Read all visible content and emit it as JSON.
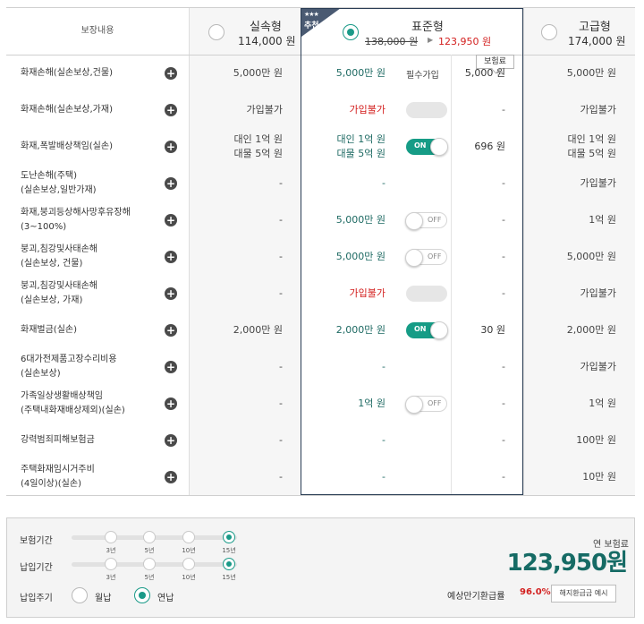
{
  "header": {
    "coverage_label": "보장내용",
    "plans": [
      {
        "name": "실속형",
        "price": "114,000 원",
        "selected": false
      },
      {
        "name": "표준형",
        "old_price": "138,000 원",
        "price": "123,950 원",
        "selected": true,
        "badge_stars": "★★★",
        "badge": "추천"
      },
      {
        "name": "고급형",
        "price": "174,000 원",
        "selected": false
      }
    ]
  },
  "fee_tooltip": "보험료",
  "rows": [
    {
      "label": [
        "화재손해(실손보상,건물)"
      ],
      "basic": [
        "5,000만 원"
      ],
      "standard": [
        "5,000만 원"
      ],
      "standard_style": "value",
      "control": "mandatory",
      "control_text": "필수가입",
      "fee": "5,000 원",
      "premium": [
        "5,000만 원"
      ]
    },
    {
      "label": [
        "화재손해(실손보상,가재)"
      ],
      "basic": [
        "가입불가"
      ],
      "standard": [
        "가입불가"
      ],
      "standard_style": "unavailable",
      "control": "disabled",
      "fee": "-",
      "premium": [
        "가입불가"
      ]
    },
    {
      "label": [
        "화재,폭발배상책임(실손)"
      ],
      "basic": [
        "대인 1억 원",
        "대물 5억 원"
      ],
      "standard": [
        "대인 1억 원",
        "대물 5억 원"
      ],
      "standard_style": "value",
      "control": "on",
      "control_text": "ON",
      "fee": "696 원",
      "premium": [
        "대인 1억 원",
        "대물 5억 원"
      ]
    },
    {
      "label": [
        "도난손해(주택)",
        "(실손보상,일반가재)"
      ],
      "basic": [
        "-"
      ],
      "standard": [
        "-"
      ],
      "standard_style": "value",
      "control": "none",
      "fee": "-",
      "premium": [
        "가입불가"
      ]
    },
    {
      "label": [
        "화재,붕괴등상해사망후유장해",
        "(3~100%)"
      ],
      "basic": [
        "-"
      ],
      "standard": [
        "5,000만 원"
      ],
      "standard_style": "value",
      "control": "off",
      "control_text": "OFF",
      "fee": "-",
      "premium": [
        "1억 원"
      ]
    },
    {
      "label": [
        "붕괴,침강및사태손해",
        "(실손보상, 건물)"
      ],
      "basic": [
        "-"
      ],
      "standard": [
        "5,000만 원"
      ],
      "standard_style": "value",
      "control": "off",
      "control_text": "OFF",
      "fee": "-",
      "premium": [
        "5,000만 원"
      ]
    },
    {
      "label": [
        "붕괴,침강및사태손해",
        "(실손보상, 가재)"
      ],
      "basic": [
        "-"
      ],
      "standard": [
        "가입불가"
      ],
      "standard_style": "unavailable",
      "control": "disabled",
      "fee": "-",
      "premium": [
        "가입불가"
      ]
    },
    {
      "label": [
        "화재벌금(실손)"
      ],
      "basic": [
        "2,000만 원"
      ],
      "standard": [
        "2,000만 원"
      ],
      "standard_style": "value",
      "control": "on",
      "control_text": "ON",
      "fee": "30 원",
      "premium": [
        "2,000만 원"
      ]
    },
    {
      "label": [
        "6대가전제품고장수리비용",
        "(실손보상)"
      ],
      "basic": [
        "-"
      ],
      "standard": [
        "-"
      ],
      "standard_style": "value",
      "control": "none",
      "fee": "-",
      "premium": [
        "가입불가"
      ]
    },
    {
      "label": [
        "가족일상생활배상책임",
        "(주택내화재배상제외)(실손)"
      ],
      "basic": [
        "-"
      ],
      "standard": [
        "1억 원"
      ],
      "standard_style": "value",
      "control": "off",
      "control_text": "OFF",
      "fee": "-",
      "premium": [
        "1억 원"
      ]
    },
    {
      "label": [
        "강력범죄피해보험금"
      ],
      "basic": [
        "-"
      ],
      "standard": [
        "-"
      ],
      "standard_style": "value",
      "control": "none",
      "fee": "-",
      "premium": [
        "100만 원"
      ]
    },
    {
      "label": [
        "주택화재임시거주비",
        "(4일이상)(실손)"
      ],
      "basic": [
        "-"
      ],
      "standard": [
        "-"
      ],
      "standard_style": "value",
      "control": "none",
      "fee": "-",
      "premium": [
        "10만 원"
      ]
    }
  ],
  "settings": {
    "insurance_period": {
      "label": "보험기간",
      "options": [
        "3년",
        "5년",
        "10년",
        "15년"
      ],
      "selected": "15년"
    },
    "payment_period": {
      "label": "납입기간",
      "options": [
        "3년",
        "5년",
        "10년",
        "15년"
      ],
      "selected": "15년"
    },
    "payment_cycle": {
      "label": "납입주기",
      "options": [
        "월납",
        "연납"
      ],
      "selected": "연납"
    }
  },
  "summary": {
    "annual_label": "연 보험료",
    "annual_value": "123,950원",
    "refund_label": "예상만기환급률",
    "refund_rate": "96.0%",
    "refund_button": "해지환급금 예시"
  },
  "colors": {
    "accent": "#1a9a88",
    "highlight_text": "#1e6a63",
    "red": "#d3201f",
    "frame": "#2a3d55"
  }
}
